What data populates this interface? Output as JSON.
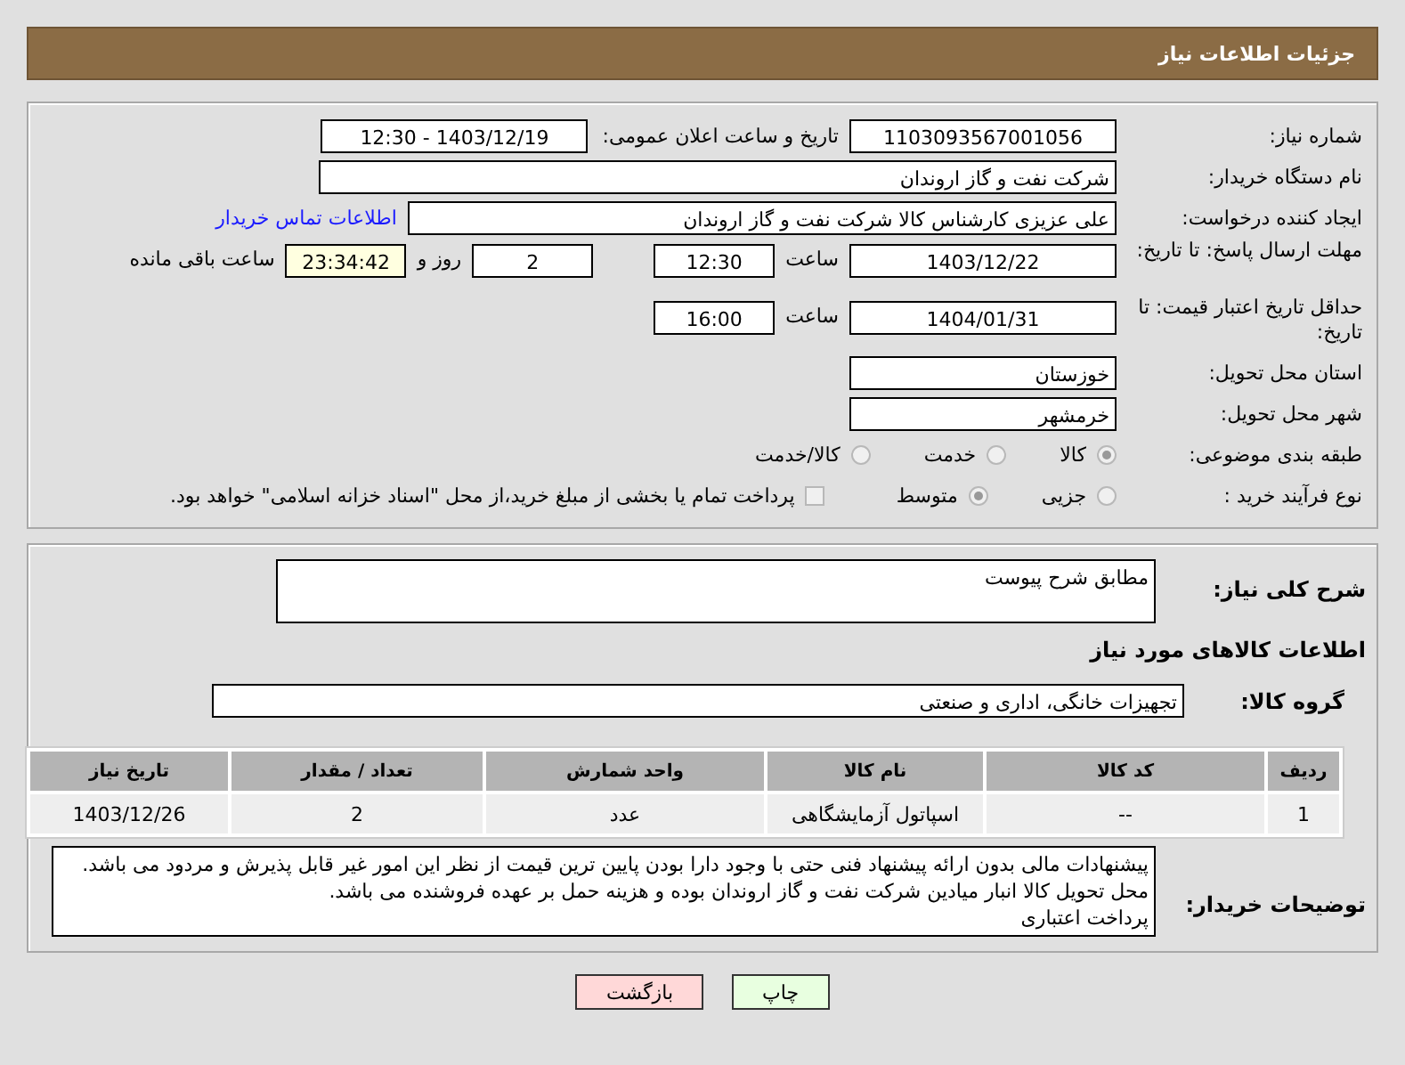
{
  "header": {
    "title": "جزئیات اطلاعات نیاز"
  },
  "need_number": {
    "label": "شماره نیاز:",
    "value": "1103093567001056"
  },
  "announce": {
    "label": "تاریخ و ساعت اعلان عمومی:",
    "value": "1403/12/19 - 12:30"
  },
  "buyer_org": {
    "label": "نام دستگاه خریدار:",
    "value": "شرکت نفت و گاز اروندان"
  },
  "requester": {
    "label": "ایجاد کننده درخواست:",
    "value": "علی عزیزی کارشناس کالا شرکت نفت و گاز اروندان",
    "link": "اطلاعات تماس خریدار"
  },
  "reply_deadline": {
    "label": "مهلت ارسال پاسخ: تا تاریخ:",
    "date": "1403/12/22",
    "time_label": "ساعت",
    "time": "12:30",
    "days": "2",
    "days_label": "روز و",
    "remaining": "23:34:42",
    "remaining_label": "ساعت باقی مانده"
  },
  "price_validity": {
    "label": "حداقل تاریخ اعتبار قیمت: تا تاریخ:",
    "date": "1404/01/31",
    "time_label": "ساعت",
    "time": "16:00"
  },
  "province": {
    "label": "استان محل تحویل:",
    "value": "خوزستان"
  },
  "city": {
    "label": "شهر محل تحویل:",
    "value": "خرمشهر"
  },
  "category": {
    "label": "طبقه بندی موضوعی:",
    "options": [
      {
        "label": "کالا",
        "selected": true
      },
      {
        "label": "خدمت",
        "selected": false
      },
      {
        "label": "کالا/خدمت",
        "selected": false
      }
    ]
  },
  "process": {
    "label": "نوع فرآیند خرید :",
    "options": [
      {
        "label": "جزیی",
        "selected": false
      },
      {
        "label": "متوسط",
        "selected": true
      }
    ],
    "checkbox": {
      "label": "پرداخت تمام یا بخشی از مبلغ خرید،از محل \"اسناد خزانه اسلامی\" خواهد بود.",
      "checked": false
    }
  },
  "description": {
    "label": "شرح کلی نیاز:",
    "value": "مطابق شرح پیوست"
  },
  "goods_title": "اطلاعات کالاهای مورد نیاز",
  "goods_group": {
    "label": "گروه کالا:",
    "value": "تجهیزات خانگی، اداری و صنعتی"
  },
  "table": {
    "columns": [
      "ردیف",
      "کد کالا",
      "نام کالا",
      "واحد شمارش",
      "تعداد / مقدار",
      "تاریخ نیاز"
    ],
    "rows": [
      [
        "1",
        "--",
        "اسپاتول آزمایشگاهی",
        "عدد",
        "2",
        "1403/12/26"
      ]
    ]
  },
  "buyer_notes": {
    "label": "توضیحات خریدار:",
    "lines": [
      "پیشنهادات مالی بدون ارائه پیشنهاد فنی حتی با وجود دارا بودن پایین ترین قیمت از نظر این امور غیر قابل پذیرش و مردود می باشد.",
      "محل تحویل کالا انبار میادین شرکت نفت و گاز اروندان بوده و هزینه حمل بر عهده فروشنده می باشد.",
      "پرداخت اعتباری"
    ]
  },
  "buttons": [
    {
      "label": "چاپ",
      "kind": "print"
    },
    {
      "label": "بازگشت",
      "kind": "back"
    }
  ]
}
